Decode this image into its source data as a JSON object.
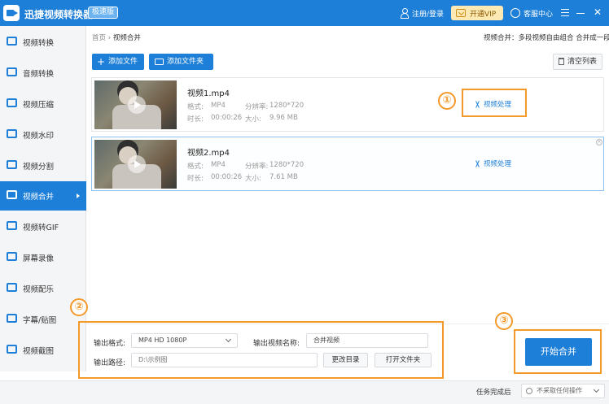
{
  "titlebar": {
    "app_name": "迅捷视频转换器",
    "edition_badge": "极速版",
    "login_label": "注册/登录",
    "vip_label": "开通VIP",
    "service_label": "客服中心",
    "accent_color": "#1e7fd8"
  },
  "sidebar": {
    "items": [
      {
        "label": "视频转换",
        "icon": "video-convert-icon"
      },
      {
        "label": "音频转换",
        "icon": "audio-convert-icon"
      },
      {
        "label": "视频压缩",
        "icon": "compress-icon"
      },
      {
        "label": "视频水印",
        "icon": "watermark-icon"
      },
      {
        "label": "视频分割",
        "icon": "split-icon"
      },
      {
        "label": "视频合并",
        "icon": "merge-icon",
        "active": true
      },
      {
        "label": "视频转GIF",
        "icon": "gif-icon"
      },
      {
        "label": "屏幕录像",
        "icon": "record-icon"
      },
      {
        "label": "视频配乐",
        "icon": "music-icon"
      },
      {
        "label": "字幕/贴图",
        "icon": "subtitle-icon"
      },
      {
        "label": "视频截图",
        "icon": "screenshot-icon"
      }
    ]
  },
  "breadcrumb": {
    "home": "首页",
    "sep": "›",
    "current": "视频合并"
  },
  "hint": "视频合并：多段视频自由组合 合并成一段",
  "toolbar": {
    "add_file": "添加文件",
    "add_folder": "添加文件夹",
    "clear_list": "清空列表"
  },
  "files": [
    {
      "name": "视频1.mp4",
      "format_key": "格式:",
      "format": "MP4",
      "resolution_key": "分辨率:",
      "resolution": "1280*720",
      "duration_key": "时长:",
      "duration": "00:00:26",
      "size_key": "大小:",
      "size": "9.96 MB",
      "action": "视频处理"
    },
    {
      "name": "视频2.mp4",
      "format_key": "格式:",
      "format": "MP4",
      "resolution_key": "分辨率:",
      "resolution": "1280*720",
      "duration_key": "时长:",
      "duration": "00:00:26",
      "size_key": "大小:",
      "size": "7.61 MB",
      "action": "视频处理"
    }
  ],
  "output": {
    "format_label": "输出格式:",
    "format_value": "MP4  HD 1080P",
    "name_label": "输出视频名称:",
    "name_value": "合并视频",
    "path_label": "输出路径:",
    "path_value": "D:\\示例图",
    "change_dir": "更改目录",
    "open_folder": "打开文件夹"
  },
  "start_button": "开始合并",
  "status": {
    "after_label": "任务完成后",
    "after_value": "不采取任何操作"
  },
  "annotations": {
    "one": "①",
    "two": "②",
    "three": "③",
    "color": "#f39a2b"
  }
}
